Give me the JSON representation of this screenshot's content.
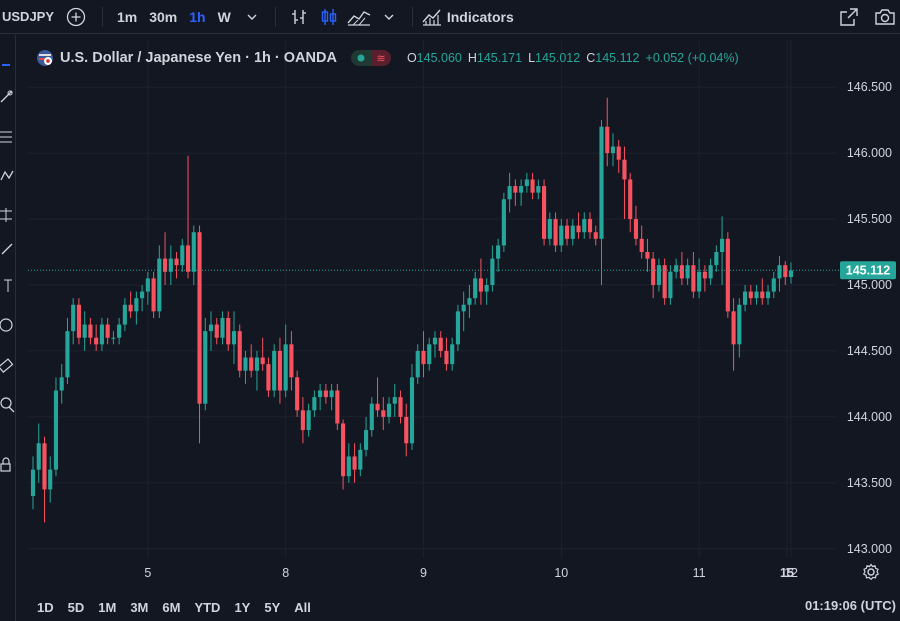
{
  "toolbar": {
    "symbol": "USDJPY",
    "intervals": [
      "1m",
      "30m",
      "1h",
      "W"
    ],
    "active_interval": "1h",
    "indicators_label": "Indicators"
  },
  "legend": {
    "title": "U.S. Dollar / Japanese Yen · 1h · OANDA",
    "ohlc": [
      {
        "key": "O",
        "value": "145.060"
      },
      {
        "key": "H",
        "value": "145.171"
      },
      {
        "key": "L",
        "value": "145.012"
      },
      {
        "key": "C",
        "value": "145.112"
      },
      {
        "key": "",
        "value": "+0.052 (+0.04%)"
      }
    ]
  },
  "price_label": "145.112",
  "bottom": {
    "ranges": [
      "1D",
      "5D",
      "1M",
      "3M",
      "6M",
      "YTD",
      "1Y",
      "5Y",
      "All"
    ],
    "clock": "01:19:06 (UTC)"
  },
  "colors": {
    "background": "#131722",
    "up": "#26a69a",
    "down": "#f7525f",
    "grid": "#1e222d",
    "text": "#d1d4dc",
    "active": "#2962ff"
  },
  "chart_data": {
    "type": "candlestick",
    "title": "",
    "x_ticks": [
      "5",
      "8",
      "9",
      "10",
      "11",
      "12",
      "15"
    ],
    "y_ticks": [
      "143.000",
      "143.500",
      "144.000",
      "144.500",
      "145.000",
      "145.500",
      "146.000",
      "146.500"
    ],
    "ylim": [
      142.93,
      146.63
    ],
    "last_price": 145.112,
    "grid": true,
    "series": [
      {
        "values": [
          [
            143.4,
            143.7,
            143.3,
            143.6
          ],
          [
            143.6,
            143.95,
            143.5,
            143.8
          ],
          [
            143.8,
            143.85,
            143.2,
            143.45
          ],
          [
            143.45,
            143.7,
            143.35,
            143.6
          ],
          [
            143.6,
            144.3,
            143.55,
            144.2
          ],
          [
            144.2,
            144.4,
            144.1,
            144.3
          ],
          [
            144.3,
            144.75,
            144.25,
            144.65
          ],
          [
            144.65,
            144.9,
            144.55,
            144.85
          ],
          [
            144.85,
            144.9,
            144.55,
            144.6
          ],
          [
            144.6,
            144.8,
            144.5,
            144.7
          ],
          [
            144.7,
            144.75,
            144.55,
            144.6
          ],
          [
            144.6,
            144.7,
            144.5,
            144.55
          ],
          [
            144.55,
            144.75,
            144.5,
            144.7
          ],
          [
            144.7,
            144.75,
            144.55,
            144.6
          ],
          [
            144.6,
            144.65,
            144.55,
            144.6
          ],
          [
            144.6,
            144.75,
            144.55,
            144.7
          ],
          [
            144.7,
            144.9,
            144.65,
            144.85
          ],
          [
            144.85,
            144.95,
            144.75,
            144.8
          ],
          [
            144.8,
            144.95,
            144.7,
            144.9
          ],
          [
            144.9,
            145.0,
            144.8,
            144.95
          ],
          [
            144.95,
            145.1,
            144.85,
            145.05
          ],
          [
            145.05,
            145.1,
            144.75,
            144.8
          ],
          [
            144.8,
            145.3,
            144.75,
            145.2
          ],
          [
            145.2,
            145.4,
            145.0,
            145.1
          ],
          [
            145.1,
            145.3,
            145.0,
            145.2
          ],
          [
            145.2,
            145.25,
            145.05,
            145.15
          ],
          [
            145.15,
            145.35,
            145.1,
            145.3
          ],
          [
            145.3,
            145.98,
            145.05,
            145.1
          ],
          [
            145.1,
            145.45,
            145.0,
            145.4
          ],
          [
            145.4,
            145.45,
            143.8,
            144.1
          ],
          [
            144.1,
            144.75,
            144.05,
            144.65
          ],
          [
            144.65,
            144.8,
            144.5,
            144.7
          ],
          [
            144.7,
            144.75,
            144.55,
            144.6
          ],
          [
            144.6,
            144.8,
            144.55,
            144.75
          ],
          [
            144.75,
            144.8,
            144.5,
            144.55
          ],
          [
            144.55,
            144.8,
            144.4,
            144.65
          ],
          [
            144.65,
            144.7,
            144.3,
            144.35
          ],
          [
            144.35,
            144.5,
            144.25,
            144.45
          ],
          [
            144.45,
            144.55,
            144.3,
            144.35
          ],
          [
            144.35,
            144.5,
            144.2,
            144.45
          ],
          [
            144.45,
            144.6,
            144.35,
            144.4
          ],
          [
            144.4,
            144.45,
            144.15,
            144.2
          ],
          [
            144.2,
            144.55,
            144.15,
            144.5
          ],
          [
            144.5,
            144.6,
            144.1,
            144.2
          ],
          [
            144.2,
            144.7,
            144.15,
            144.55
          ],
          [
            144.55,
            144.65,
            144.2,
            144.3
          ],
          [
            144.3,
            144.35,
            144.0,
            144.05
          ],
          [
            144.05,
            144.15,
            143.8,
            143.9
          ],
          [
            143.9,
            144.1,
            143.85,
            144.05
          ],
          [
            144.05,
            144.2,
            144.0,
            144.15
          ],
          [
            144.15,
            144.25,
            144.05,
            144.2
          ],
          [
            144.2,
            144.25,
            144.1,
            144.15
          ],
          [
            144.15,
            144.25,
            144.05,
            144.2
          ],
          [
            144.2,
            144.25,
            143.9,
            143.95
          ],
          [
            143.95,
            143.98,
            143.45,
            143.55
          ],
          [
            143.55,
            143.8,
            143.5,
            143.7
          ],
          [
            143.7,
            143.8,
            143.5,
            143.6
          ],
          [
            143.6,
            143.8,
            143.55,
            143.75
          ],
          [
            143.75,
            144.0,
            143.7,
            143.9
          ],
          [
            143.9,
            144.15,
            143.85,
            144.1
          ],
          [
            144.1,
            144.3,
            144.0,
            144.05
          ],
          [
            144.05,
            144.15,
            143.9,
            144.0
          ],
          [
            144.0,
            144.15,
            143.95,
            144.1
          ],
          [
            144.1,
            144.25,
            144.0,
            144.15
          ],
          [
            144.15,
            144.2,
            143.95,
            144.0
          ],
          [
            144.0,
            144.1,
            143.7,
            143.8
          ],
          [
            143.8,
            144.4,
            143.75,
            144.3
          ],
          [
            144.3,
            144.55,
            144.25,
            144.5
          ],
          [
            144.5,
            144.65,
            144.3,
            144.4
          ],
          [
            144.4,
            144.6,
            144.35,
            144.55
          ],
          [
            144.55,
            144.65,
            144.45,
            144.6
          ],
          [
            144.6,
            144.65,
            144.45,
            144.5
          ],
          [
            144.5,
            144.6,
            144.35,
            144.4
          ],
          [
            144.4,
            144.6,
            144.35,
            144.55
          ],
          [
            144.55,
            144.85,
            144.5,
            144.8
          ],
          [
            144.8,
            144.95,
            144.65,
            144.85
          ],
          [
            144.85,
            145.0,
            144.75,
            144.9
          ],
          [
            144.9,
            145.1,
            144.85,
            145.05
          ],
          [
            145.05,
            145.2,
            144.85,
            144.95
          ],
          [
            144.95,
            145.05,
            144.85,
            145.0
          ],
          [
            145.0,
            145.3,
            144.95,
            145.2
          ],
          [
            145.2,
            145.35,
            145.1,
            145.3
          ],
          [
            145.3,
            145.7,
            145.25,
            145.65
          ],
          [
            145.65,
            145.85,
            145.55,
            145.75
          ],
          [
            145.75,
            145.8,
            145.6,
            145.7
          ],
          [
            145.7,
            145.8,
            145.6,
            145.75
          ],
          [
            145.75,
            145.85,
            145.7,
            145.8
          ],
          [
            145.8,
            145.85,
            145.65,
            145.7
          ],
          [
            145.7,
            145.8,
            145.65,
            145.75
          ],
          [
            145.75,
            145.8,
            145.3,
            145.35
          ],
          [
            145.35,
            145.55,
            145.3,
            145.5
          ],
          [
            145.5,
            145.55,
            145.25,
            145.3
          ],
          [
            145.3,
            145.5,
            145.25,
            145.45
          ],
          [
            145.45,
            145.5,
            145.3,
            145.35
          ],
          [
            145.35,
            145.5,
            145.3,
            145.45
          ],
          [
            145.45,
            145.55,
            145.35,
            145.4
          ],
          [
            145.4,
            145.55,
            145.35,
            145.5
          ],
          [
            145.5,
            145.55,
            145.35,
            145.4
          ],
          [
            145.4,
            145.45,
            145.3,
            145.35
          ],
          [
            145.35,
            146.25,
            145.0,
            146.2
          ],
          [
            146.2,
            146.42,
            145.9,
            146.0
          ],
          [
            146.0,
            146.15,
            145.9,
            146.05
          ],
          [
            146.05,
            146.1,
            145.85,
            145.95
          ],
          [
            145.95,
            146.05,
            145.5,
            145.8
          ],
          [
            145.8,
            145.85,
            145.4,
            145.5
          ],
          [
            145.5,
            145.6,
            145.3,
            145.35
          ],
          [
            145.35,
            145.45,
            145.2,
            145.25
          ],
          [
            145.25,
            145.35,
            145.1,
            145.2
          ],
          [
            145.2,
            145.25,
            144.9,
            145.0
          ],
          [
            145.0,
            145.2,
            144.95,
            145.15
          ],
          [
            145.15,
            145.2,
            144.85,
            144.9
          ],
          [
            144.9,
            145.15,
            144.85,
            145.1
          ],
          [
            145.1,
            145.2,
            145.05,
            145.15
          ],
          [
            145.15,
            145.25,
            145.0,
            145.05
          ],
          [
            145.05,
            145.2,
            145.0,
            145.15
          ],
          [
            145.15,
            145.25,
            144.9,
            144.95
          ],
          [
            144.95,
            145.2,
            144.9,
            145.1
          ],
          [
            145.1,
            145.15,
            144.95,
            145.05
          ],
          [
            145.05,
            145.2,
            145.0,
            145.15
          ],
          [
            145.15,
            145.3,
            145.1,
            145.25
          ],
          [
            145.25,
            145.52,
            145.0,
            145.35
          ],
          [
            145.35,
            145.4,
            144.75,
            144.8
          ],
          [
            144.8,
            144.9,
            144.35,
            144.55
          ],
          [
            144.55,
            144.9,
            144.45,
            144.85
          ],
          [
            144.85,
            145.0,
            144.8,
            144.95
          ],
          [
            144.95,
            145.0,
            144.85,
            144.9
          ],
          [
            144.9,
            145.0,
            144.85,
            144.95
          ],
          [
            144.95,
            145.05,
            144.85,
            144.9
          ],
          [
            144.9,
            145.0,
            144.85,
            144.95
          ],
          [
            144.95,
            145.1,
            144.9,
            145.05
          ],
          [
            145.05,
            145.22,
            144.95,
            145.15
          ],
          [
            145.15,
            145.18,
            145.0,
            145.06
          ],
          [
            145.06,
            145.17,
            145.01,
            145.11
          ]
        ]
      }
    ]
  }
}
